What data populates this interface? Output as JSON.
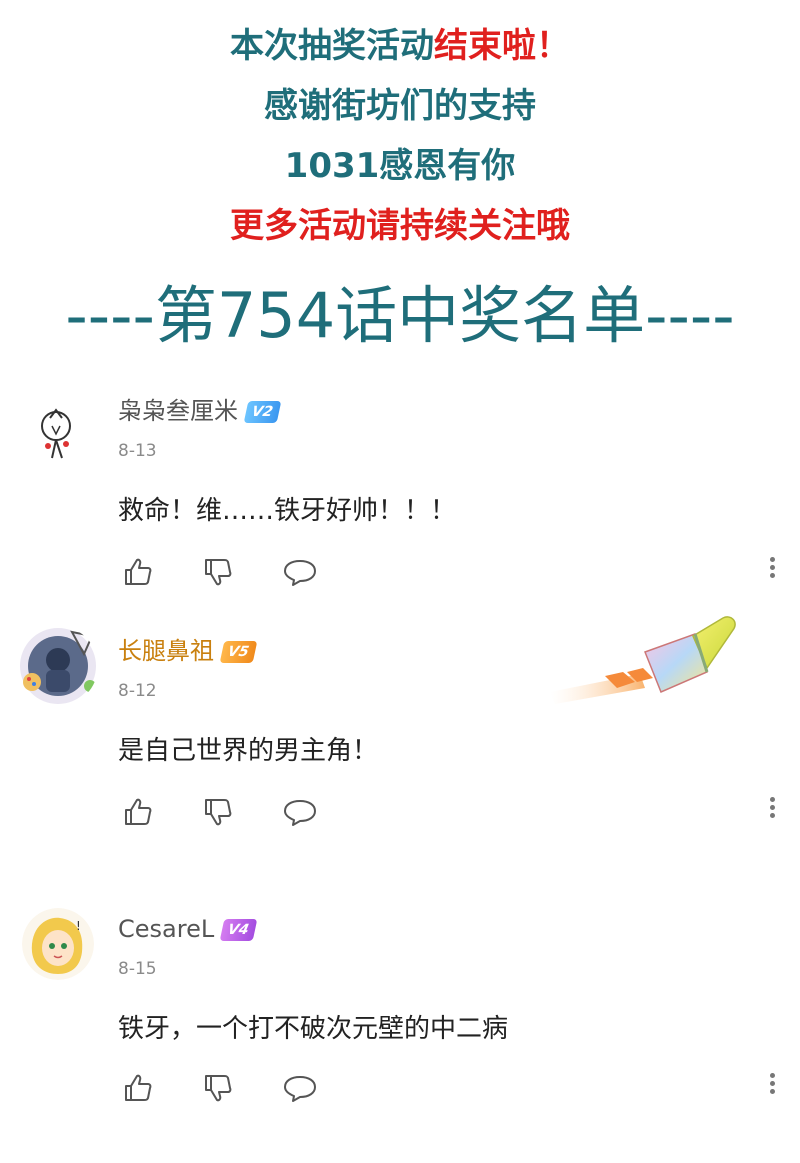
{
  "banner": {
    "line1_teal": "本次抽奖活动",
    "line1_red": "结束啦！",
    "line2": "感谢街坊们的支持",
    "line3": "1031感恩有你",
    "line4": "更多活动请持续关注哦",
    "winner_title": "----第754话中奖名单----"
  },
  "colors": {
    "teal": "#1f6e7a",
    "red": "#e0201e",
    "username_gold": "#c9800f"
  },
  "comments": [
    {
      "username": "枭枭叁厘米",
      "vip": "V2",
      "date": "8-13",
      "text": "救命！维……铁牙好帅！！！",
      "avatar_icon": "stick-figure-avatar"
    },
    {
      "username": "长腿鼻祖",
      "vip": "V5",
      "date": "8-12",
      "text": "是自己世界的男主角！",
      "avatar_icon": "painted-frame-avatar",
      "decoration": "paintbrush-icon"
    },
    {
      "username": "CesareL",
      "vip": "V4",
      "date": "8-15",
      "text": "铁牙，一个打不破次元壁的中二病",
      "avatar_icon": "blonde-character-avatar"
    }
  ],
  "icons": {
    "like": "thumbs-up-icon",
    "dislike": "thumbs-down-icon",
    "reply": "speech-bubble-icon",
    "more": "more-vertical-icon"
  }
}
